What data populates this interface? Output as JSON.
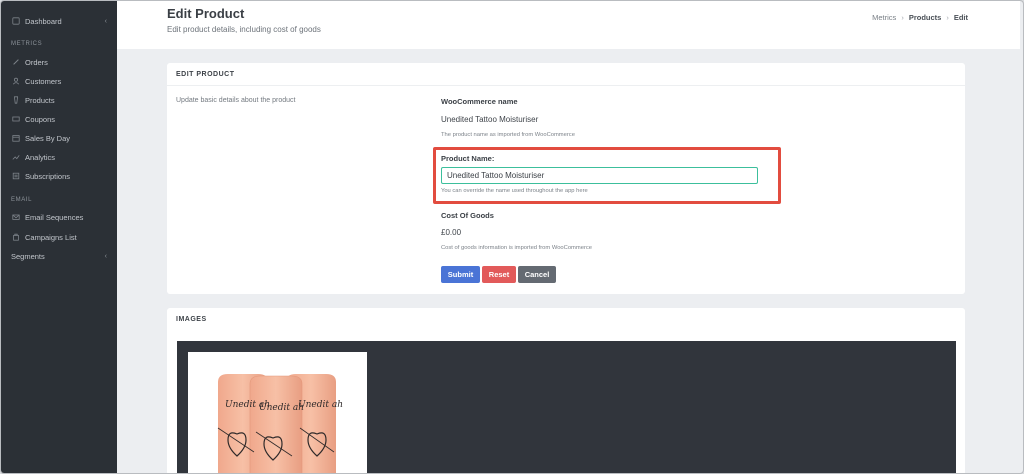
{
  "sidebar": {
    "dashboard": "Dashboard",
    "metrics_heading": "METRICS",
    "metrics_items": [
      {
        "label": "Orders",
        "icon": "orders-icon"
      },
      {
        "label": "Customers",
        "icon": "customers-icon"
      },
      {
        "label": "Products",
        "icon": "products-icon"
      },
      {
        "label": "Coupons",
        "icon": "coupons-icon"
      },
      {
        "label": "Sales By Day",
        "icon": "sales-by-day-icon"
      },
      {
        "label": "Analytics",
        "icon": "analytics-icon"
      },
      {
        "label": "Subscriptions",
        "icon": "subscriptions-icon"
      }
    ],
    "email_heading": "EMAIL",
    "email_items": [
      {
        "label": "Email Sequences",
        "icon": "email-sequences-icon"
      },
      {
        "label": "Campaigns List",
        "icon": "campaigns-icon"
      }
    ],
    "segments": "Segments"
  },
  "header": {
    "title": "Edit Product",
    "subtitle": "Edit product details, including cost of goods",
    "breadcrumb": [
      "Metrics",
      "Products",
      "Edit"
    ]
  },
  "edit_card": {
    "title": "EDIT PRODUCT",
    "description": "Update basic details about the product",
    "woo_name_label": "WooCommerce name",
    "woo_name_value": "Unedited Tattoo Moisturiser",
    "woo_name_help": "The product name as imported from WooCommerce",
    "product_name_label": "Product Name:",
    "product_name_value": "Unedited Tattoo Moisturiser",
    "product_name_help": "You can override the name used throughout the app here",
    "cost_label": "Cost Of Goods",
    "cost_value": "£0.00",
    "cost_help": "Cost of goods information is imported from WooCommerce",
    "submit": "Submit",
    "reset": "Reset",
    "cancel": "Cancel"
  },
  "images_card": {
    "title": "IMAGES",
    "tube_text": "Unedit ah"
  },
  "colors": {
    "sidebar_bg": "#2b3036",
    "submit": "#4a74d6",
    "reset": "#e25a5a",
    "cancel": "#646a72",
    "highlight": "#e24c3f",
    "input_border": "#3cbf9c"
  }
}
